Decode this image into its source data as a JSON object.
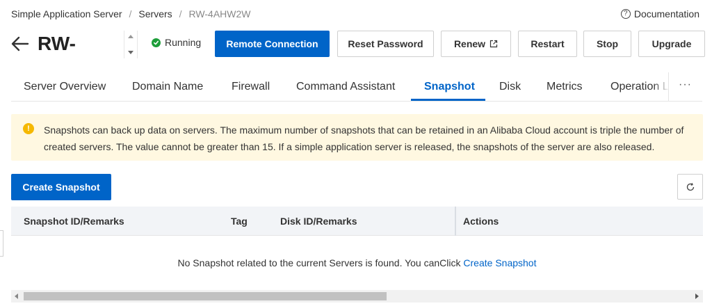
{
  "breadcrumb": {
    "item1": "Simple Application Server",
    "item2": "Servers",
    "current": "RW-4AHW2W",
    "separator": "/"
  },
  "documentation": {
    "label": "Documentation",
    "icon": "help-circle-icon"
  },
  "header": {
    "title": "RW-",
    "status": "Running",
    "status_color": "#1e9e3a"
  },
  "actions": {
    "remote_connection": "Remote Connection",
    "reset_password": "Reset Password",
    "renew": "Renew",
    "restart": "Restart",
    "stop": "Stop",
    "upgrade": "Upgrade"
  },
  "tabs": [
    {
      "label": "Server Overview"
    },
    {
      "label": "Domain Name"
    },
    {
      "label": "Firewall"
    },
    {
      "label": "Command Assistant"
    },
    {
      "label": "Snapshot",
      "active": true
    },
    {
      "label": "Disk"
    },
    {
      "label": "Metrics"
    },
    {
      "label": "Operation L"
    }
  ],
  "tabs_more": "···",
  "alert": {
    "icon_glyph": "!",
    "text": "Snapshots can back up data on servers. The maximum number of snapshots that can be retained in an Alibaba Cloud account is triple the number of created servers. The value cannot be greater than 15. If a simple application server is released, the snapshots of the server are also released."
  },
  "create_snapshot_button": "Create Snapshot",
  "table": {
    "columns": [
      "Snapshot ID/Remarks",
      "Tag",
      "Disk ID/Remarks",
      "Actions"
    ],
    "empty_message": "No Snapshot related to the current Servers is found. You canClick",
    "empty_link": "Create Snapshot"
  },
  "colors": {
    "primary": "#0064c8",
    "alert_bg": "#fff8e1",
    "alert_icon": "#f5b800",
    "header_bg": "#f2f4f7"
  }
}
